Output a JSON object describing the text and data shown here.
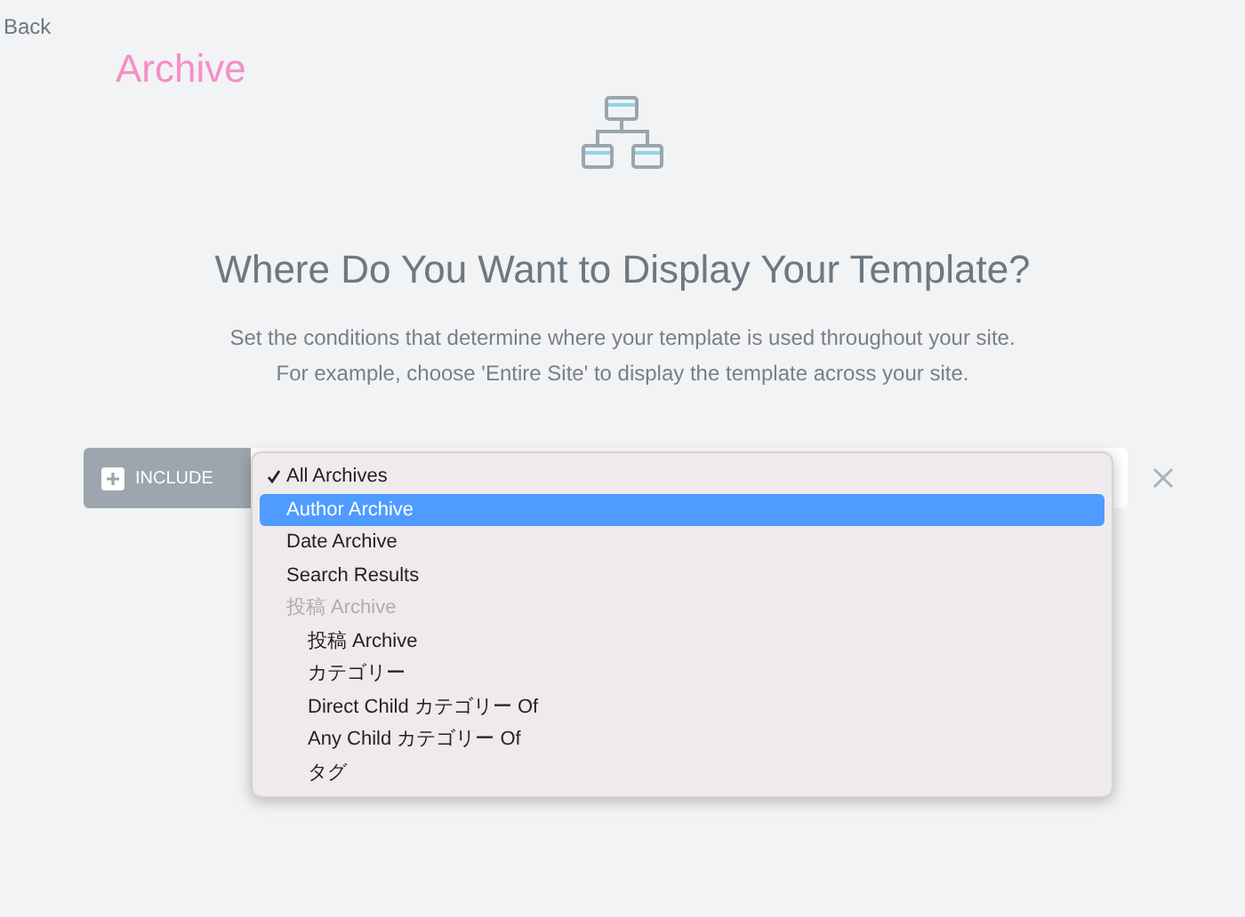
{
  "back_link": "Back",
  "page_title": "Archive",
  "heading": "Where Do You Want to Display Your Template?",
  "description": [
    "Set the conditions that determine where your template is used throughout your site.",
    "For example, choose 'Entire Site' to display the template across your site."
  ],
  "condition": {
    "include_label": "INCLUDE"
  },
  "menu": {
    "items": [
      {
        "label": "All Archives",
        "checked": true,
        "selected": false
      },
      {
        "label": "Author Archive",
        "checked": false,
        "selected": true
      },
      {
        "label": "Date Archive",
        "checked": false,
        "selected": false
      },
      {
        "label": "Search Results",
        "checked": false,
        "selected": false
      },
      {
        "label": "投稿 Archive",
        "kind": "group",
        "children": [
          {
            "label": "投稿 Archive",
            "checked": false,
            "selected": false
          },
          {
            "label": "カテゴリー",
            "checked": false,
            "selected": false
          },
          {
            "label": "Direct Child カテゴリー Of",
            "checked": false,
            "selected": false
          },
          {
            "label": "Any Child カテゴリー Of",
            "checked": false,
            "selected": false
          },
          {
            "label": "タグ",
            "checked": false,
            "selected": false
          }
        ]
      }
    ]
  }
}
